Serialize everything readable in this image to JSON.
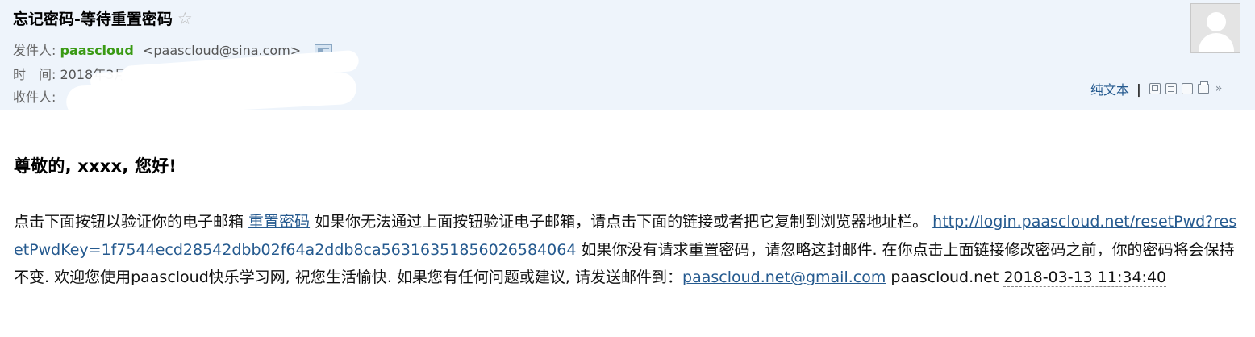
{
  "email": {
    "subject": "忘记密码-等待重置密码",
    "star_icon": "star-outline-icon",
    "sender": {
      "label": "发件人:",
      "name": "paascloud",
      "address": "<paascloud@sina.com>"
    },
    "time": {
      "label": "时　间:",
      "value": "2018年3月13日(星期二"
    },
    "recipient": {
      "label": "收件人:"
    },
    "toolbar": {
      "plain_text": "纯文本",
      "separator": "|",
      "icons": [
        "new-window-icon",
        "view-source-icon",
        "save-icon",
        "print-icon",
        "more-chevron-icon"
      ]
    }
  },
  "body": {
    "greeting": "尊敬的, xxxx, 您好!",
    "text_intro": "点击下面按钮以验证你的电子邮箱 ",
    "reset_link_label": "重置密码",
    "text_fallback": " 如果你无法通过上面按钮验证电子邮箱，请点击下面的链接或者把它复制到浏览器地址栏。 ",
    "reset_url": "http://login.paascloud.net/resetPwd?resetPwdKey=1f7544ecd28542dbb02f64a2ddb8ca56316351856026584064",
    "text_ignore": " 如果你没有请求重置密码，请忽略这封邮件. 在你点击上面链接修改密码之前，你的密码将会保持不变. 欢迎您使用paascloud快乐学习网, 祝您生活愉快. 如果您有任何问题或建议, 请发送邮件到：",
    "support_email": "paascloud.net@gmail.com",
    "signature_site": " paascloud.net ",
    "signature_date": "2018-03-13 11:34:40"
  }
}
